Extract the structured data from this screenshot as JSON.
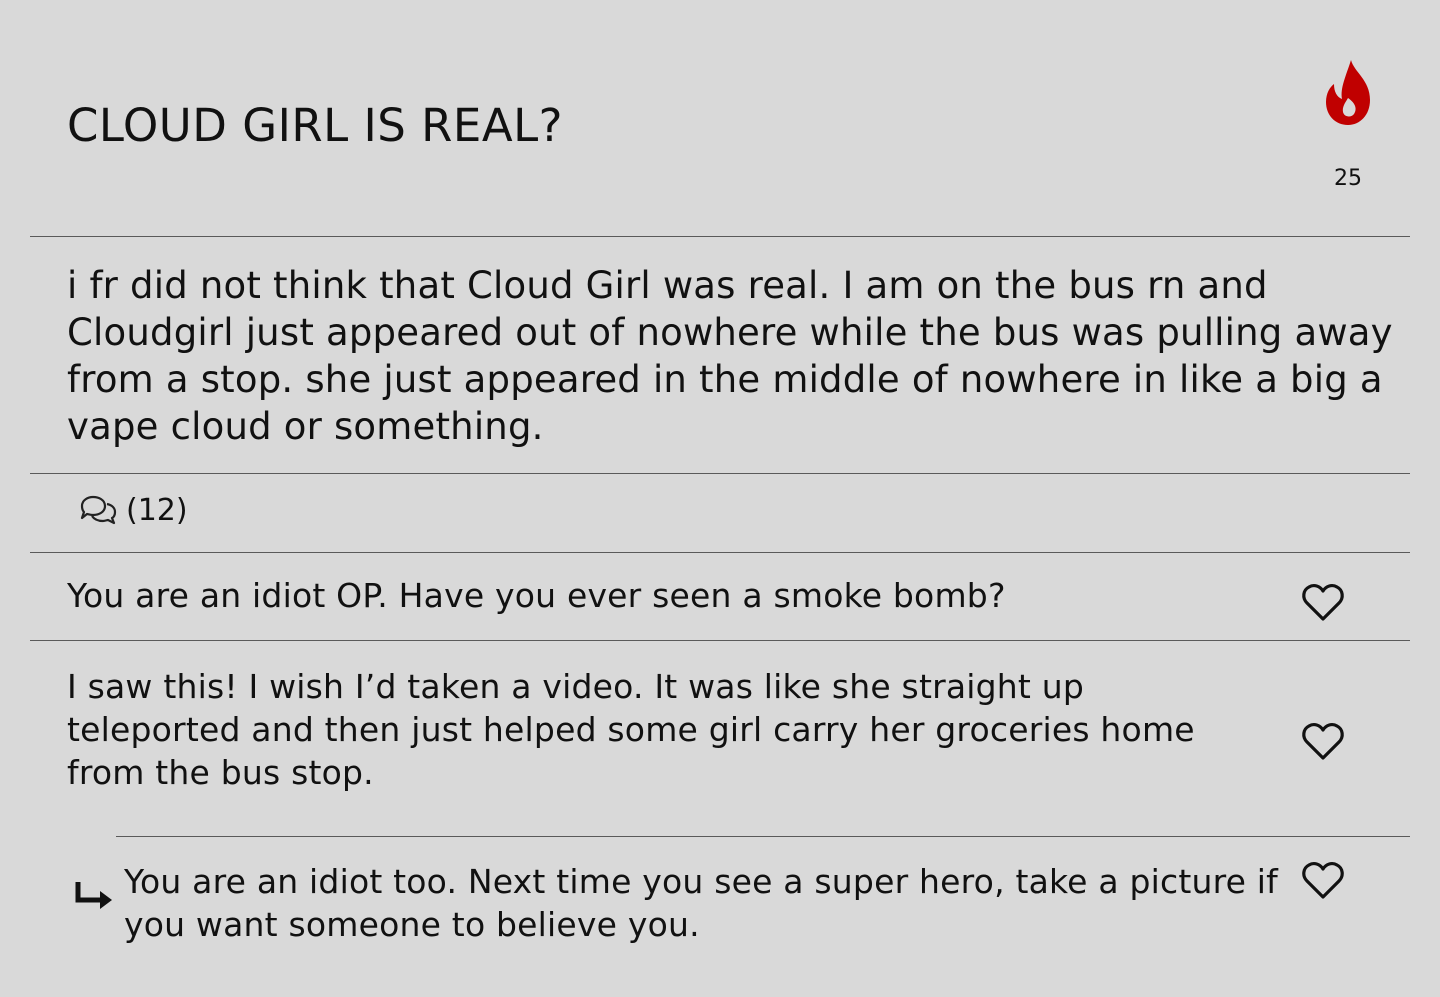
{
  "post": {
    "title": "CLOUD GIRL IS REAL?",
    "hot_count": "25",
    "hot_icon": "flame-icon",
    "hot_color": "#c00000",
    "body": "i fr did not think that Cloud Girl was real. I am on the bus rn and Cloudgirl just appeared out of nowhere while the bus was pulling away from a stop. she just appeared in the middle of nowhere in like a big a vape cloud or something."
  },
  "comments_bar": {
    "icon": "comments-icon",
    "count_label": "(12)"
  },
  "comments": [
    {
      "text": "You are an idiot OP. Have you ever seen a smoke bomb?",
      "like_icon": "heart-icon"
    },
    {
      "text": "I saw this! I wish I’d taken a video. It was like she straight up teleported and then just helped some girl carry her groceries home from the bus stop.",
      "like_icon": "heart-icon"
    },
    {
      "text": "You are an idiot too. Next time you see a super hero, take a picture if you want someone to believe you.",
      "like_icon": "heart-icon",
      "reply_icon": "reply-arrow-icon"
    }
  ]
}
